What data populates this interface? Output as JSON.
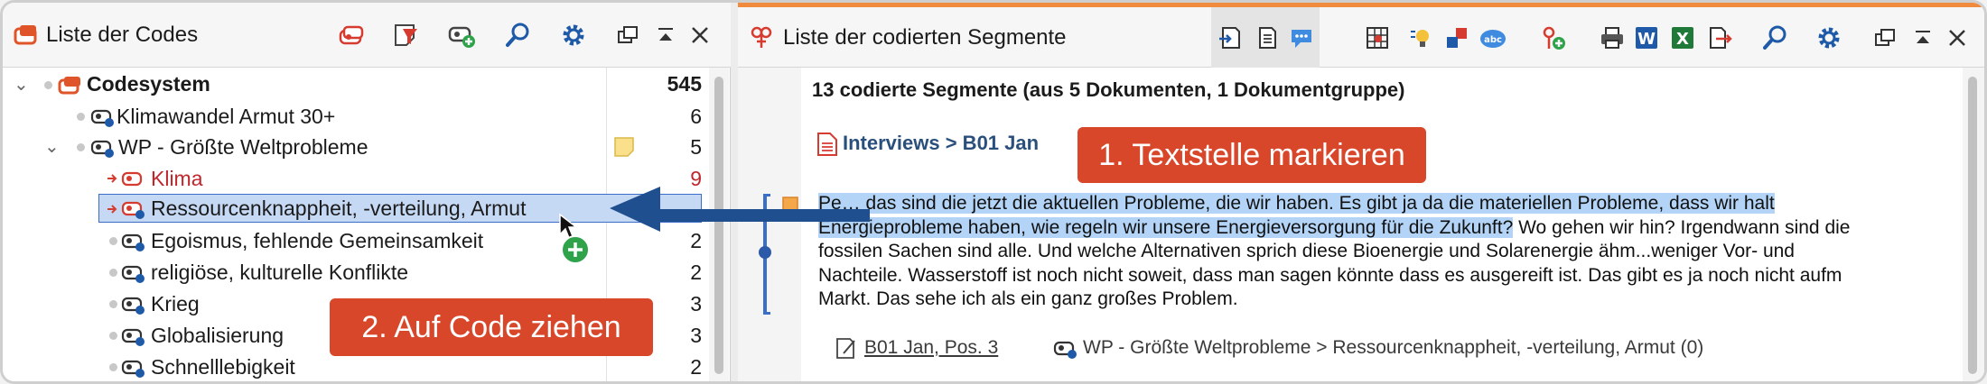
{
  "left_panel": {
    "title": "Liste der Codes",
    "toolbar_icons": [
      "code-set-icon",
      "filter-icon",
      "new-code-icon",
      "search-icon",
      "settings-icon",
      "undock-icon",
      "collapse-icon",
      "close-icon"
    ],
    "tree": [
      {
        "label": "Codesystem",
        "count": "545",
        "bold": true,
        "level": 0
      },
      {
        "label": "Klimawandel Armut 30+",
        "count": "6",
        "level": 1
      },
      {
        "label": "WP - Größte Weltprobleme",
        "count": "5",
        "level": 1,
        "memo": true
      },
      {
        "label": "Klima",
        "count": "9",
        "level": 2,
        "color": "#c0272d"
      },
      {
        "label": "Ressourcenknappheit, -verteilung, Armut",
        "count": "",
        "level": 2,
        "selected": true
      },
      {
        "label": "Egoismus, fehlende Gemeinsamkeit",
        "count": "2",
        "level": 2
      },
      {
        "label": "religiöse, kulturelle Konflikte",
        "count": "2",
        "level": 2
      },
      {
        "label": "Krieg",
        "count": "3",
        "level": 2
      },
      {
        "label": "Globalisierung",
        "count": "3",
        "level": 2
      },
      {
        "label": "Schnelllebigkeit",
        "count": "2",
        "level": 2
      }
    ]
  },
  "right_panel": {
    "title": "Liste der codierten Segmente",
    "summary": "13 codierte Segmente (aus 5 Dokumenten, 1 Dokumentgruppe)",
    "document_path": "Interviews > B01 Jan",
    "segment_lines": [
      {
        "hl": "Pe… das sind die jetzt die aktuellen Probleme, die wir haben. Es gibt ja da die materiellen Probleme, dass wir halt",
        "plain": ""
      },
      {
        "hl": "Energieprobleme haben, wie regeln wir unsere Energieversorgung für die Zukunft?",
        "plain": " Wo gehen wir hin? Irgendwann sind die"
      },
      {
        "hl": "",
        "plain": "fossilen Sachen sind alle. Und welche Alternativen sprich diese Bioenergie und Solarenergie ähm...weniger Vor- und"
      },
      {
        "hl": "",
        "plain": "Nachteile. Wasserstoff ist noch nicht soweit, dass man sagen könnte dass es ausgereift ist. Das gibt es ja noch nicht aufm"
      },
      {
        "hl": "",
        "plain": "Markt. Das sehe ich als ein ganz großes Problem."
      }
    ],
    "source_ref": "B01 Jan, Pos. 3",
    "code_ref": "WP - Größte Weltprobleme > Ressourcenknappheit, -verteilung, Armut (0)"
  },
  "callouts": {
    "step1": "1. Textstelle markieren",
    "step2": "2. Auf Code ziehen"
  },
  "colors": {
    "accent": "#f08a3c",
    "callout": "#d9472b",
    "selection": "#c6d9f4",
    "highlight": "#b3d4f7",
    "arrow": "#1f4f8f"
  }
}
